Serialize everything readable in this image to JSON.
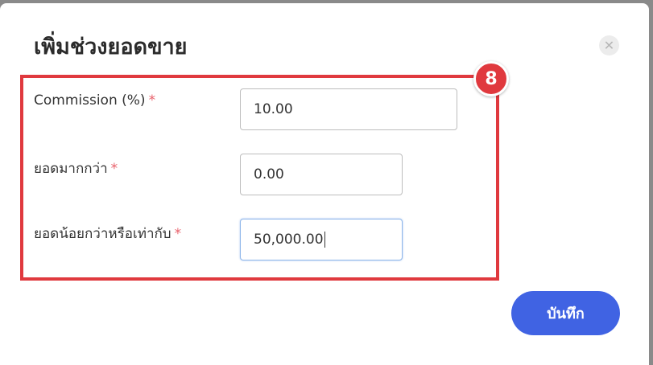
{
  "modal": {
    "title": "เพิ่มช่วงยอดขาย",
    "close_icon": "close-icon"
  },
  "annotation": {
    "badge_number": "8",
    "color": "#e0393e"
  },
  "form": {
    "fields": [
      {
        "label": "Commission (%)",
        "required_mark": "*",
        "value": "10.00"
      },
      {
        "label": "ยอดมากกว่า",
        "required_mark": "*",
        "value": "0.00"
      },
      {
        "label": "ยอดน้อยกว่าหรือเท่ากับ",
        "required_mark": "*",
        "value": "50,000.00"
      }
    ]
  },
  "footer": {
    "save_label": "บันทึก",
    "save_color": "#4063e3"
  }
}
